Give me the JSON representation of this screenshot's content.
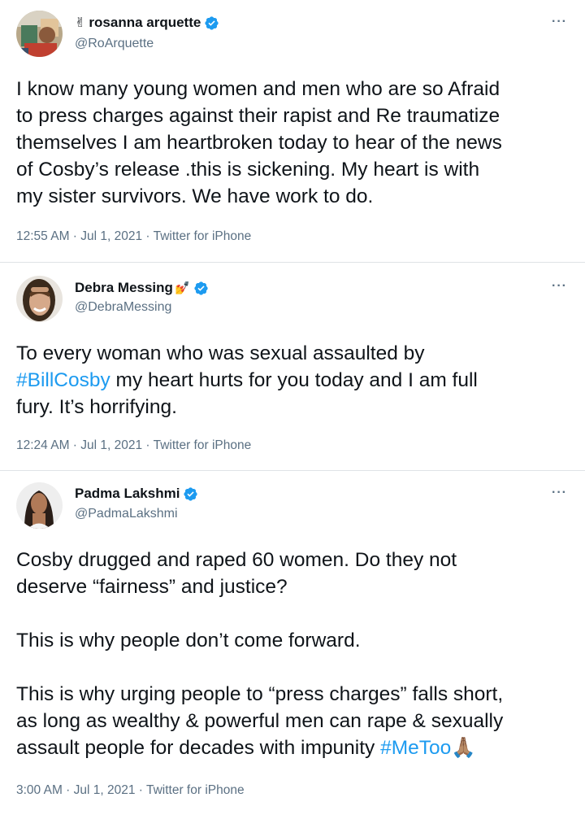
{
  "tweets": [
    {
      "name_prefix_emoji": "✌",
      "display_name": "rosanna arquette",
      "name_suffix_emoji": "",
      "handle": "@RoArquette",
      "lines": [
        "I know many young women and men who are so Afraid",
        "to press charges against their rapist and Re traumatize",
        "themselves I am heartbroken today to hear of the news",
        "of Cosby’s release  .this is sickening. My heart is with",
        "my sister survivors. We have work to do."
      ],
      "timestamp": "12:55 AM · Jul 1, 2021 · Twitter for iPhone"
    },
    {
      "name_prefix_emoji": "",
      "display_name": "Debra Messing",
      "name_suffix_emoji": "💅",
      "handle": "@DebraMessing",
      "line1": "To every woman who was sexual assaulted by",
      "line2_hashtag": "#BillCosby",
      "line2_rest": " my heart hurts for you today and I am full",
      "line3": "fury. It’s horrifying.",
      "timestamp": "12:24 AM · Jul 1, 2021 · Twitter for iPhone"
    },
    {
      "name_prefix_emoji": "",
      "display_name": "Padma Lakshmi",
      "name_suffix_emoji": "",
      "handle": "@PadmaLakshmi",
      "para1_line1": "Cosby drugged and raped 60 women. Do they not",
      "para1_line2": "deserve “fairness” and justice?",
      "para2": "This is why people don’t come forward.",
      "para3_line1": "This is why urging people to “press charges” falls short,",
      "para3_line2": "as long as wealthy & powerful men can rape & sexually",
      "para3_line3": "assault people for decades with impunity ",
      "para3_hashtag": "#MeToo",
      "para3_emoji": "🙏🏽",
      "timestamp": "3:00 AM · Jul 1, 2021 · Twitter for iPhone"
    }
  ],
  "more_label": "···",
  "colors": {
    "text": "#0f1419",
    "secondary": "#5b7083",
    "link": "#1d9bf0",
    "verified": "#1d9bf0",
    "divider": "#dfe3e6"
  },
  "icons": {
    "verified": "verified-badge-icon",
    "more": "more-options-icon"
  }
}
